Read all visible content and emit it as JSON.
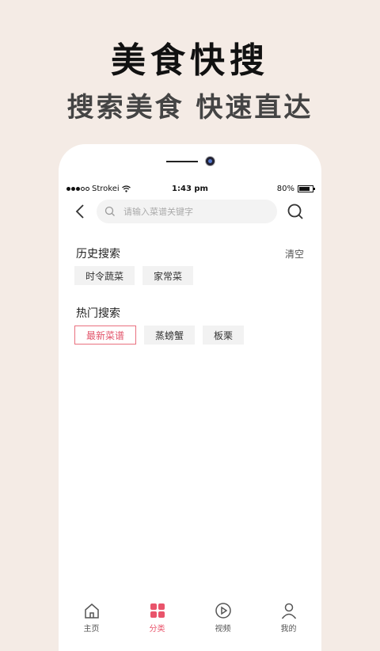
{
  "promo": {
    "title": "美食快搜",
    "subtitle": "搜索美食 快速直达"
  },
  "status_bar": {
    "carrier": "Strokei",
    "time": "1:43 pm",
    "battery": "80%"
  },
  "search": {
    "placeholder": "请输入菜谱关键字",
    "back_icon": "chevron-left-icon",
    "search_icon": "search-icon"
  },
  "history": {
    "title": "历史搜索",
    "clear_label": "清空",
    "tags": [
      "时令蔬菜",
      "家常菜"
    ]
  },
  "hot": {
    "title": "热门搜索",
    "tags": [
      "最新菜谱",
      "蒸螃蟹",
      "板栗"
    ]
  },
  "tabbar": {
    "items": [
      {
        "label": "主页",
        "icon": "home-icon",
        "active": false
      },
      {
        "label": "分类",
        "icon": "category-grid-icon",
        "active": true
      },
      {
        "label": "视频",
        "icon": "play-icon",
        "active": false
      },
      {
        "label": "我的",
        "icon": "user-icon",
        "active": false
      }
    ]
  },
  "colors": {
    "background": "#f4ebe5",
    "accent": "#e9546b"
  }
}
